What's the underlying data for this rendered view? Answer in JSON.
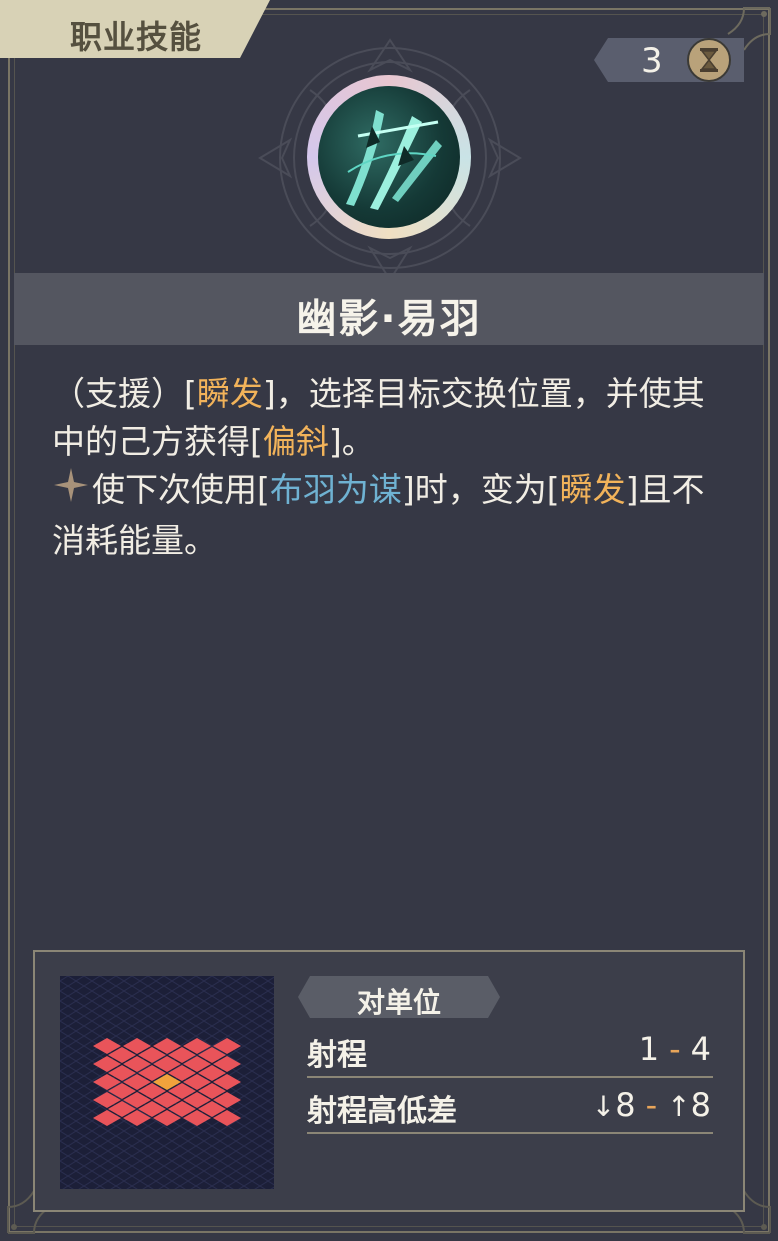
{
  "category": {
    "label": "职业技能"
  },
  "cost": {
    "value": "3",
    "icon": "hourglass-icon"
  },
  "skill": {
    "name": "幽影·易羽",
    "icon": "feather-blades-icon"
  },
  "description": {
    "line1": {
      "prefix": "（支援）[",
      "kw1": "瞬发",
      "mid": "]，选择目标交换位置，并使其中的己方获得[",
      "kw2": "偏斜",
      "suffix": "]。"
    },
    "line2": {
      "icon": "sparkle-icon",
      "prefix": "使下次使用[",
      "kw1": "布羽为谋",
      "mid": "]时，变为[",
      "kw2": "瞬发",
      "suffix": "]且不消耗能量。"
    }
  },
  "targeting": {
    "tag": "对单位",
    "range_label": "射程",
    "range_min": "1",
    "range_sep": "-",
    "range_max": "4",
    "height_label": "射程高低差",
    "height_down": "8",
    "height_up": "8",
    "height_down_icon": "arrow-down-icon",
    "height_up_icon": "arrow-up-icon"
  },
  "colors": {
    "keyword_orange": "#f2b35a",
    "keyword_blue": "#6fb2d2",
    "range_cell": "#e9545a",
    "center_cell": "#f0a23c"
  }
}
